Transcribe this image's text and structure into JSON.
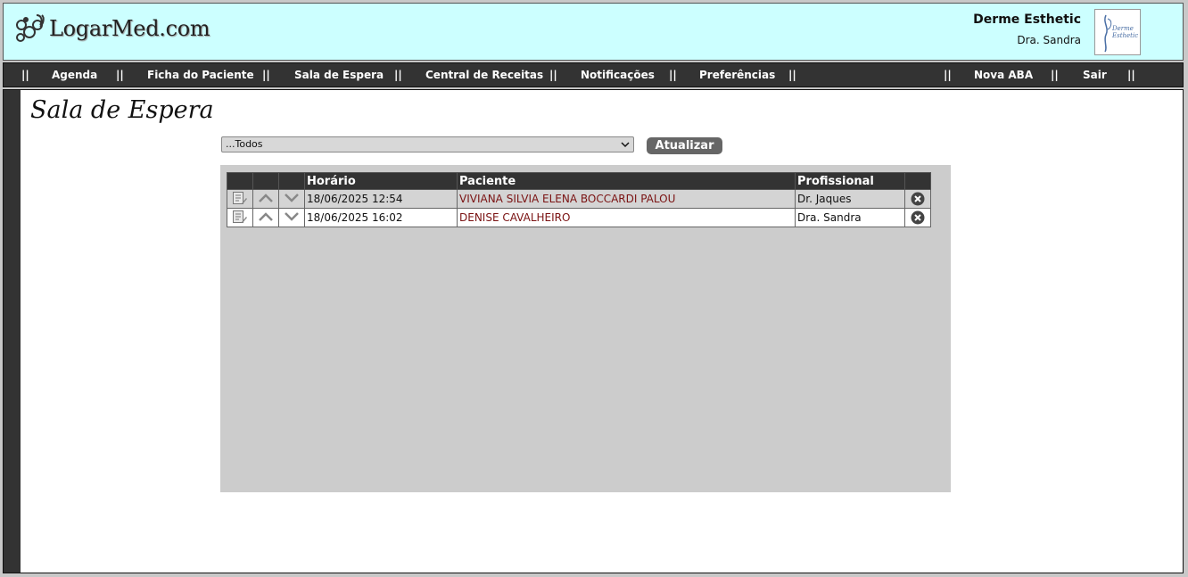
{
  "header": {
    "site_name": "LogarMed.com",
    "clinic_name": "Derme Esthetic",
    "doctor_name": "Dra. Sandra",
    "clinic_logo_text": "Derme Esthetic"
  },
  "nav": {
    "separator": "||",
    "items": [
      "Agenda",
      "Ficha do Paciente",
      "Sala de Espera",
      "Central de Receitas",
      "Notificações",
      "Preferências"
    ],
    "right_items": [
      "Nova ABA",
      "Sair"
    ]
  },
  "page": {
    "title": "Sala de Espera",
    "filter_selected": "...Todos",
    "refresh_label": "Atualizar"
  },
  "table": {
    "columns": [
      "",
      "",
      "",
      "Horário",
      "Paciente",
      "Profissional",
      ""
    ],
    "rows": [
      {
        "time": "18/06/2025 12:54",
        "patient": "VIVIANA SILVIA ELENA BOCCARDI PALOU",
        "professional": "Dr. Jaques"
      },
      {
        "time": "18/06/2025 16:02",
        "patient": "DENISE CAVALHEIRO",
        "professional": "Dra. Sandra"
      }
    ]
  },
  "colors": {
    "header_bg": "#ccffff",
    "nav_bg": "#333333",
    "patient_text": "#7a1212",
    "panel_bg": "#cccccc"
  }
}
